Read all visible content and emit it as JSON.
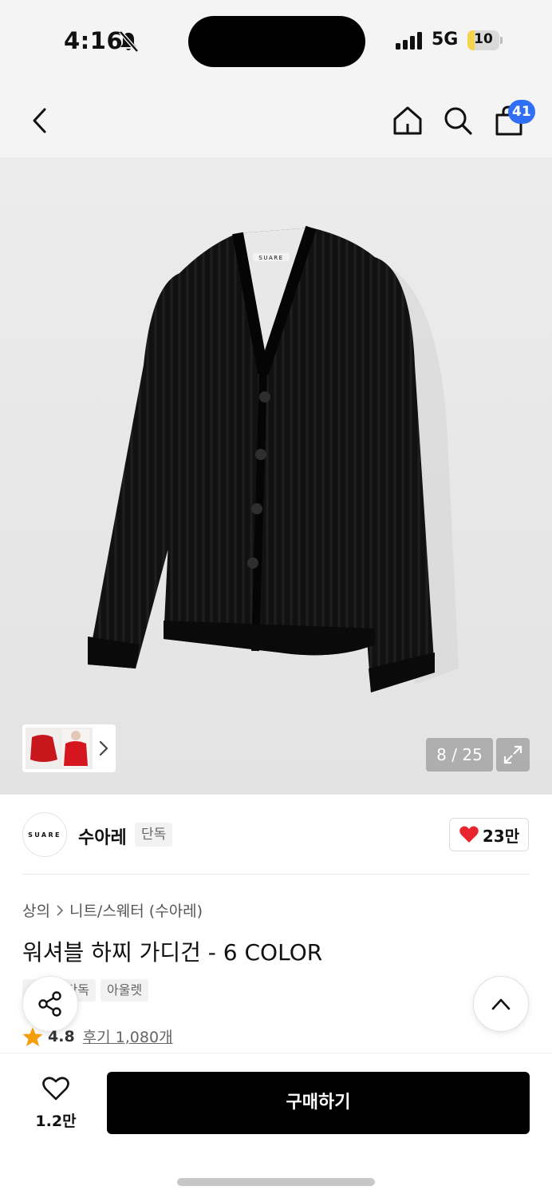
{
  "status_bar": {
    "time": "4:16",
    "network": "5G",
    "battery_level": "10",
    "battery_fraction": 0.1,
    "bell_icon": "bell-slash-icon",
    "signal_icon": "signal-bars-icon"
  },
  "nav": {
    "back_icon": "chevron-left-icon",
    "home_icon": "home-icon",
    "search_icon": "search-icon",
    "cart_icon": "shopping-bag-icon",
    "cart_badge": "41"
  },
  "gallery": {
    "image_alt": "black knit cardigan",
    "counter": "8 / 25",
    "expand_icon": "expand-icon",
    "thumb_chevron_icon": "chevron-right-icon",
    "label_on_garment": "SUARE"
  },
  "brand": {
    "logo_text": "SUARE",
    "name": "수아레",
    "tag": "단독",
    "like_count": "23만",
    "like_icon": "heart-filled-icon"
  },
  "product": {
    "breadcrumb": [
      "상의",
      "니트/스웨터 (수아레)"
    ],
    "title": "워셔블 하찌 가디건 - 6 COLOR",
    "tags": [
      "단독",
      "아울렛"
    ],
    "rating": "4.8",
    "review_label": "후기 1,080개",
    "star_icon": "star-icon"
  },
  "actions": {
    "share_icon": "share-icon",
    "scroll_top_icon": "chevron-up-icon",
    "wish_icon": "heart-outline-icon",
    "wish_count": "1.2만",
    "buy_label": "구매하기"
  },
  "colors": {
    "accent_blue": "#2f6ef5",
    "heart_red": "#e8242e",
    "star_orange": "#f59d0a",
    "buy_black": "#000000"
  }
}
